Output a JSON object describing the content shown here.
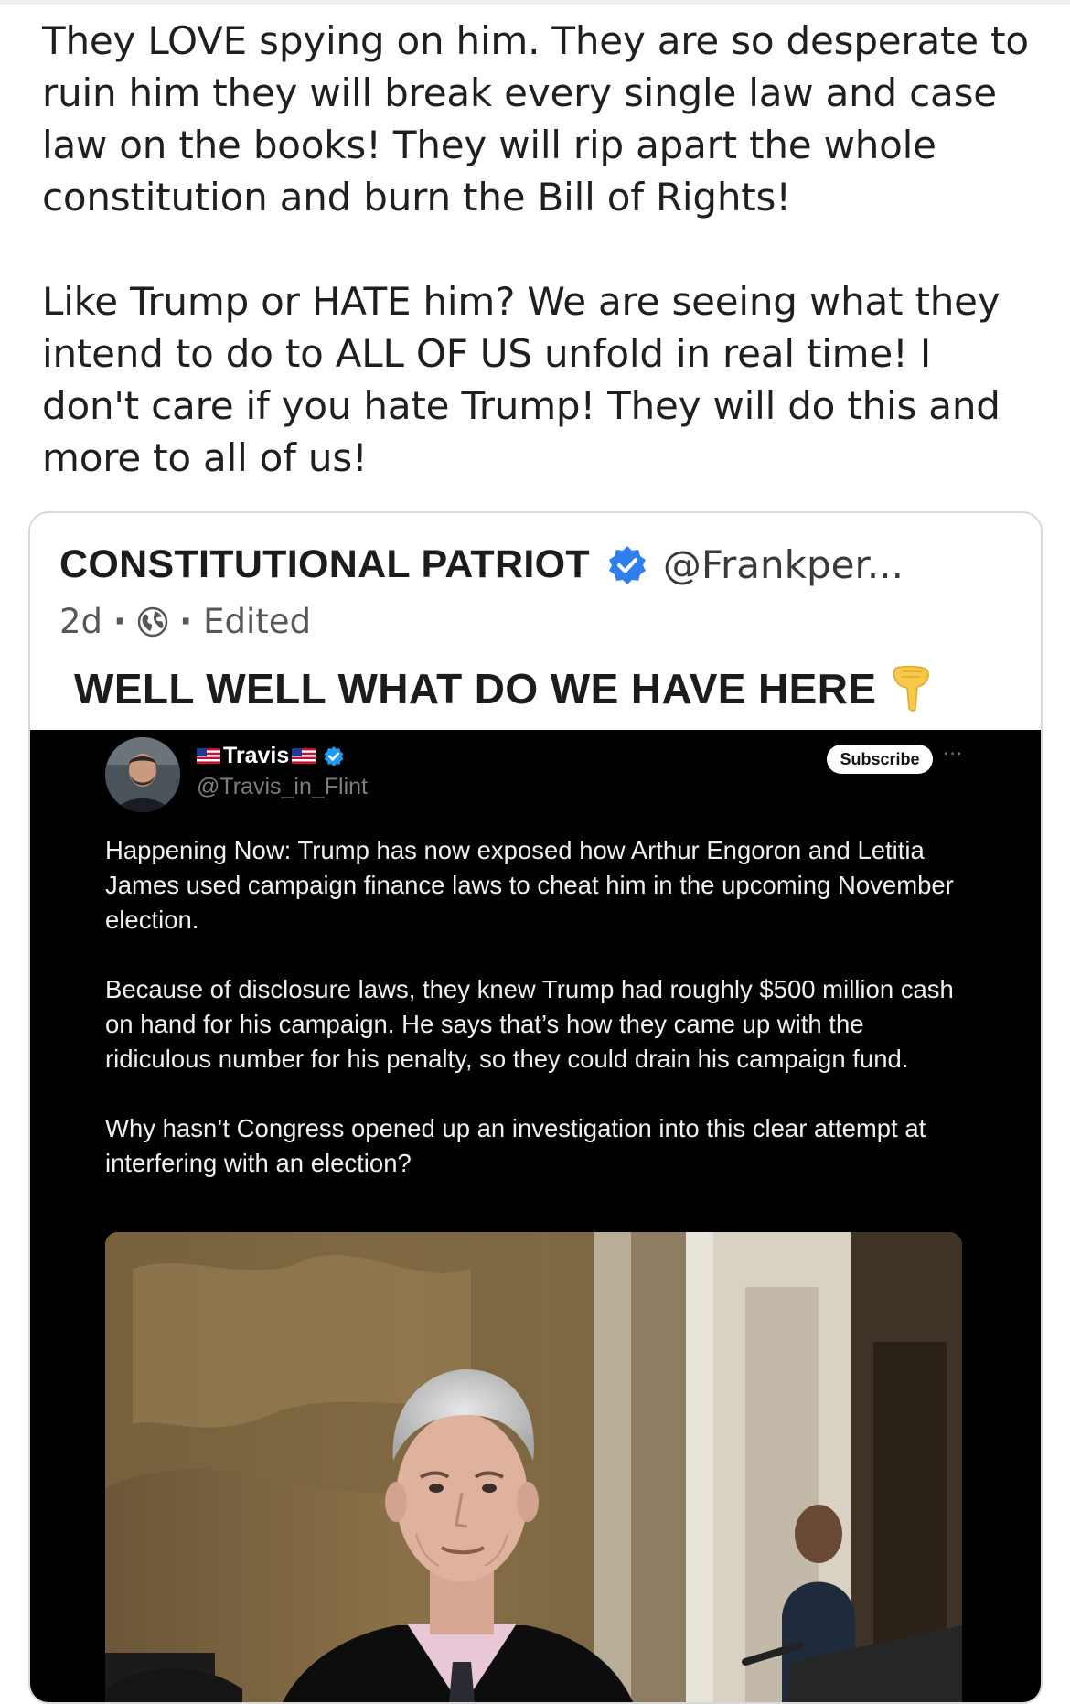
{
  "post": {
    "paragraph_1": "They LOVE spying on him. They are so desperate to ruin him they will break every single law and case law on the books! They will rip apart the whole constitution and burn the Bill of Rights!",
    "paragraph_2": "Like Trump or HATE him? We are seeing what they intend to do to ALL OF US unfold in real time! I don't care if you hate Trump! They will do this and more to all of us!"
  },
  "quoted_post": {
    "author_name": "CONSTITUTIONAL PATRIOT",
    "handle": "@Frankper...",
    "age": "2d",
    "separator": "·",
    "edited_label": "Edited",
    "title": "WELL WELL WHAT DO WE HAVE HERE",
    "icons": {
      "verified": "verified-badge-icon",
      "visibility": "globe-icon",
      "emoji": "backhand-index-pointing-down-icon"
    },
    "colors": {
      "verified_blue": "#2f80ed",
      "emoji_yellow": "#f7c948"
    }
  },
  "embedded_tweet": {
    "display_name": "Travis",
    "handle": "@Travis_in_Flint",
    "subscribe_label": "Subscribe",
    "more_label": "···",
    "paragraphs": [
      "Happening Now:  Trump has now exposed how Arthur Engoron and Letitia James used campaign finance laws to cheat him in the upcoming November election.",
      "Because of disclosure laws, they knew Trump had roughly $500 million cash on hand for his campaign.  He says that’s how they came up with the ridiculous number for his penalty, so they could drain his campaign fund.",
      "Why hasn’t Congress opened up an investigation into this clear attempt at interfering with an election?"
    ],
    "icons": {
      "flag": "us-flag-icon",
      "verified": "verified-badge-icon"
    },
    "colors": {
      "background": "#000000",
      "text": "#eef0f2",
      "muted": "#7a7f85",
      "verified_blue": "#1d9bf0"
    }
  }
}
